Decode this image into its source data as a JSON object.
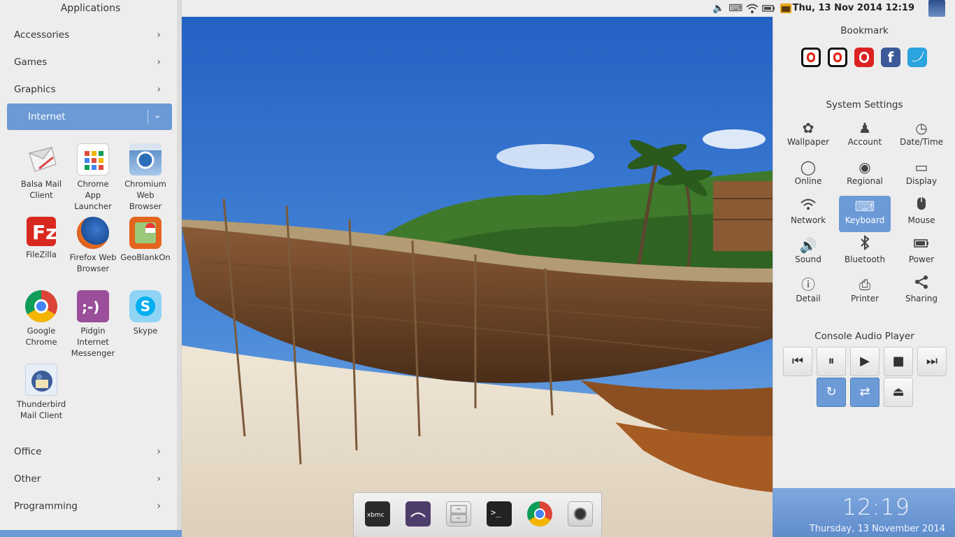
{
  "menu": {
    "header": "Applications",
    "categories_top": [
      "Accessories",
      "Games",
      "Graphics"
    ],
    "active_category": "Internet",
    "apps": [
      {
        "line1": "Balsa Mail",
        "line2": "Client",
        "line3": ""
      },
      {
        "line1": "Chrome",
        "line2": "App",
        "line3": "Launcher"
      },
      {
        "line1": "Chromium",
        "line2": "Web",
        "line3": "Browser"
      },
      {
        "line1": "FileZilla",
        "line2": "",
        "line3": ""
      },
      {
        "line1": "Firefox Web",
        "line2": "Browser",
        "line3": ""
      },
      {
        "line1": "GeoBlankOn",
        "line2": "",
        "line3": ""
      },
      {
        "line1": "Google",
        "line2": "Chrome",
        "line3": ""
      },
      {
        "line1": "Pidgin",
        "line2": "Internet",
        "line3": "Messenger"
      },
      {
        "line1": "Skype",
        "line2": "",
        "line3": ""
      },
      {
        "line1": "Thunderbird",
        "line2": "Mail Client",
        "line3": ""
      }
    ],
    "categories_bottom": [
      "Office",
      "Other",
      "Programming"
    ]
  },
  "topbar": {
    "datetime": "Thu, 13 Nov 2014 12:19"
  },
  "right": {
    "bookmark_title": "Bookmark",
    "bookmark_icons": [
      "opera-icon",
      "opera-icon",
      "opera-red-icon",
      "facebook-icon",
      "twitter-icon"
    ],
    "settings_title": "System Settings",
    "settings": [
      "Wallpaper",
      "Account",
      "Date/Time",
      "Online",
      "Regional",
      "Display",
      "Network",
      "Keyboard",
      "Mouse",
      "Sound",
      "Bluetooth",
      "Power",
      "Detail",
      "Printer",
      "Sharing"
    ],
    "active_setting": "Keyboard",
    "audio_title": "Console Audio Player"
  },
  "clock": {
    "time": "12:19",
    "date": "Thursday, 13 November 2014"
  },
  "colors": {
    "accent": "#6b9ad6",
    "sky": "#2d6fc8",
    "sand": "#ebe2d2"
  }
}
